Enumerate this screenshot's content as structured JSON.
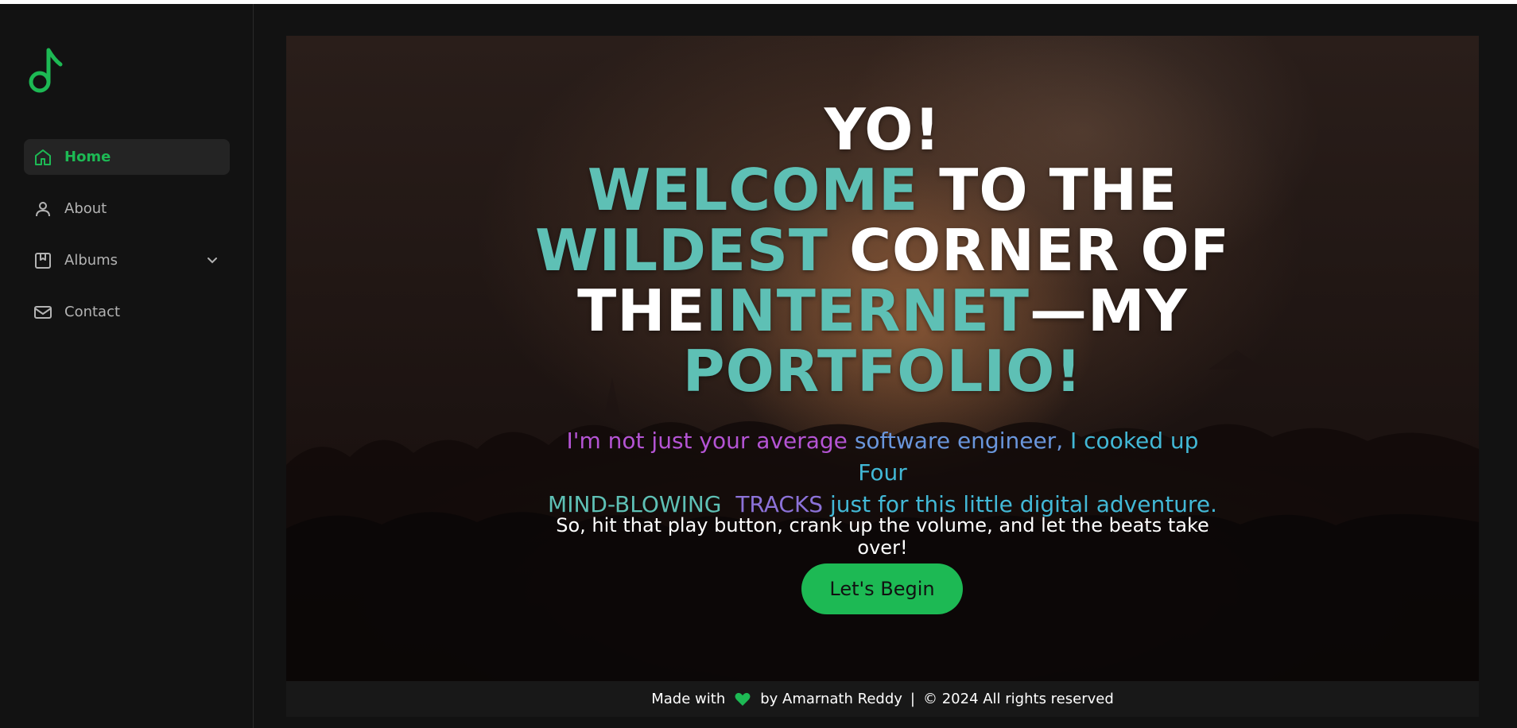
{
  "sidebar": {
    "logo_icon": "music-note-icon",
    "items": [
      {
        "label": "Home",
        "icon": "home-icon",
        "active": true
      },
      {
        "label": "About",
        "icon": "user-icon",
        "active": false
      },
      {
        "label": "Albums",
        "icon": "bookmark-icon",
        "active": false,
        "has_dropdown": true
      },
      {
        "label": "Contact",
        "icon": "mail-icon",
        "active": false
      }
    ]
  },
  "hero": {
    "headline": {
      "line1": "YO!",
      "word_welcome": "WELCOME",
      "to_the": " TO THE",
      "word_wildest": "WILDEST",
      "corner_of": " CORNER OF",
      "the": "THE",
      "word_internet": "INTERNET",
      "dash_my": "—MY",
      "word_portfolio": "PORTFOLIO!"
    },
    "tagline": {
      "p1": "I'm not just your average ",
      "p2": "software engineer, ",
      "p3": "I cooked up Four",
      "p4": "MIND-BLOWING",
      "p5": "TRACKS",
      "p6": " just for this little digital adventure."
    },
    "subline": "So, hit that play button, crank up the volume, and let the beats take over!",
    "cta_label": "Let's Begin"
  },
  "footer": {
    "made_with": "Made with",
    "by": "by Amarnath Reddy",
    "separator": "|",
    "copyright": "© 2024 All rights reserved"
  },
  "colors": {
    "accent": "#1db954",
    "teal": "#5ec0b5",
    "background": "#121212"
  }
}
